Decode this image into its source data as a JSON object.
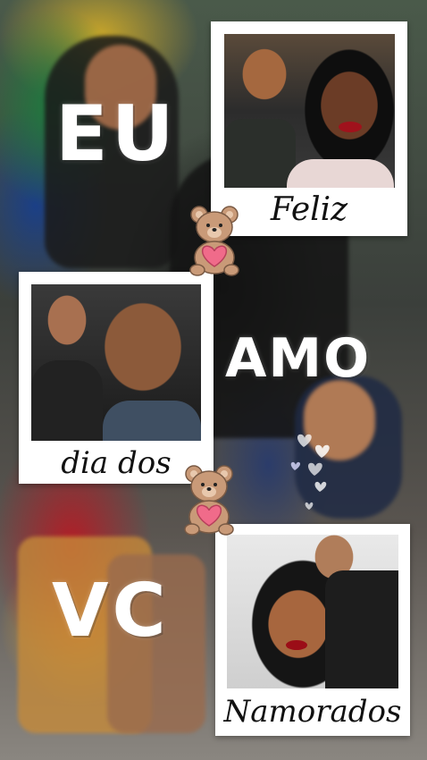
{
  "overlay_words": {
    "eu": "EU",
    "amo": "AMO",
    "vc": "VC"
  },
  "polaroids": [
    {
      "caption": "Feliz"
    },
    {
      "caption": "dia dos"
    },
    {
      "caption": "Namorados"
    }
  ],
  "decorations": {
    "sticker": "teddy-bear-heart-icon",
    "hearts": "floating-hearts-icon"
  },
  "colors": {
    "heart": "#f06b8a",
    "bear": "#c99a78",
    "polaroid": "#ffffff"
  }
}
